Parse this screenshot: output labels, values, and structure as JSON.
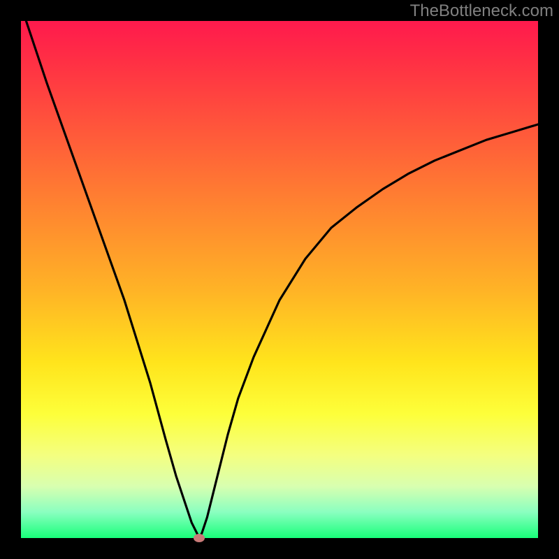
{
  "watermark": "TheBottleneck.com",
  "chart_data": {
    "type": "line",
    "title": "",
    "xlabel": "",
    "ylabel": "",
    "xlim": [
      0,
      100
    ],
    "ylim": [
      0,
      100
    ],
    "grid": false,
    "legend": false,
    "background": "rainbow-vertical-gradient",
    "series": [
      {
        "name": "bottleneck-curve",
        "color": "#000000",
        "x": [
          1,
          5,
          10,
          15,
          20,
          25,
          28,
          30,
          32,
          33,
          34,
          34.5,
          35,
          36,
          37,
          38,
          40,
          42,
          45,
          50,
          55,
          60,
          65,
          70,
          75,
          80,
          85,
          90,
          95,
          100
        ],
        "y": [
          100,
          88,
          74,
          60,
          46,
          30,
          19,
          12,
          6,
          3,
          1,
          0,
          1,
          4,
          8,
          12,
          20,
          27,
          35,
          46,
          54,
          60,
          64,
          67.5,
          70.5,
          73,
          75,
          77,
          78.5,
          80
        ]
      }
    ],
    "marker": {
      "x": 34.5,
      "y": 0,
      "color": "#c97a78",
      "shape": "ellipse"
    }
  }
}
